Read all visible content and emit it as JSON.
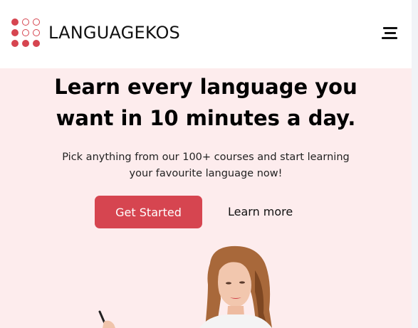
{
  "header": {
    "brand": "LANGUAGEKOS",
    "menu_icon": "hamburger-menu-icon",
    "logo_icon": "dot-grid-logo-icon"
  },
  "hero": {
    "title_line1": "Learn every language you",
    "title_line2": "want in 10 minutes a day.",
    "subtitle_line1": "Pick anything from our 100+ courses and start learning",
    "subtitle_line2": "your favourite language now!",
    "cta_label": "Get Started",
    "secondary_label": "Learn more",
    "image": "woman-holding-pen-photo"
  },
  "colors": {
    "accent": "#d64550",
    "hero_background": "#fdeced",
    "header_background": "#ffffff"
  }
}
